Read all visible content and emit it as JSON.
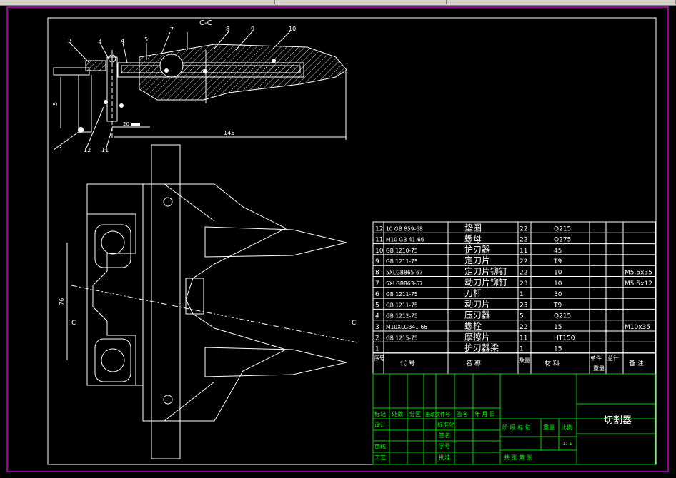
{
  "section_label": "C-C",
  "cut_mark_left": "C",
  "cut_mark_right": "C",
  "callouts": [
    "1",
    "2",
    "3",
    "4",
    "5",
    "7",
    "8",
    "9",
    "10",
    "11",
    "12"
  ],
  "dims": {
    "d5": "5",
    "d20": "20",
    "d145": "145",
    "d76": "76"
  },
  "parts_header": {
    "seq": "序号",
    "code": "代  号",
    "name": "名  称",
    "qty": "数量",
    "material": "材  料",
    "unit_wt": "单件",
    "total_wt": "总计",
    "weight": "重量",
    "remark": "备 注"
  },
  "parts": [
    {
      "no": "12",
      "code": "10 GB 859-68",
      "name": "垫圈",
      "qty": "22",
      "mat": "Q215",
      "remark": ""
    },
    {
      "no": "11",
      "code": "M10 GB 41-66",
      "name": "螺母",
      "qty": "22",
      "mat": "Q275",
      "remark": ""
    },
    {
      "no": "10",
      "code": "GB 1210-75",
      "name": "护刃器",
      "qty": "11",
      "mat": "45",
      "remark": ""
    },
    {
      "no": "9",
      "code": "GB 1211-75",
      "name": "定刀片",
      "qty": "22",
      "mat": "T9",
      "remark": ""
    },
    {
      "no": "8",
      "code": "5XLGB865-67",
      "name": "定刀片铆钉",
      "qty": "22",
      "mat": "10",
      "remark": "M5.5x35"
    },
    {
      "no": "7",
      "code": "5XLGB863-67",
      "name": "动刀片铆钉",
      "qty": "23",
      "mat": "10",
      "remark": "M5.5x12"
    },
    {
      "no": "6",
      "code": "GB 1211-75",
      "name": "刀杆",
      "qty": "1",
      "mat": "30",
      "remark": ""
    },
    {
      "no": "5",
      "code": "GB 1211-75",
      "name": "动刀片",
      "qty": "23",
      "mat": "T9",
      "remark": ""
    },
    {
      "no": "4",
      "code": "GB 1212-75",
      "name": "压刃器",
      "qty": "5",
      "mat": "Q215",
      "remark": ""
    },
    {
      "no": "3",
      "code": "M10XLGB41-66",
      "name": "螺栓",
      "qty": "22",
      "mat": "15",
      "remark": "M10x35"
    },
    {
      "no": "2",
      "code": "GB 1215-75",
      "name": "摩擦片",
      "qty": "11",
      "mat": "HT150",
      "remark": ""
    },
    {
      "no": "1",
      "code": "",
      "name": "护刃器梁",
      "qty": "1",
      "mat": "15",
      "remark": ""
    }
  ],
  "title_block": {
    "drawing_title": "切割器",
    "row_labels": [
      "标记",
      "处数",
      "分区",
      "更改文件号",
      "签名",
      "年 月 日"
    ],
    "design": "设计",
    "standard": "标准化",
    "stage": "阶 段 标 记",
    "weight": "重量",
    "scale": "比例",
    "scale_value": "1: 1",
    "review": "审核",
    "craft": "工艺",
    "approve": "批准",
    "sheet": "共    张  第    张",
    "seal1": "签名",
    "seal2": "学号"
  },
  "colors": {
    "line": "#ffffff",
    "title_block": "#00d000",
    "border": "#ff00ff"
  }
}
